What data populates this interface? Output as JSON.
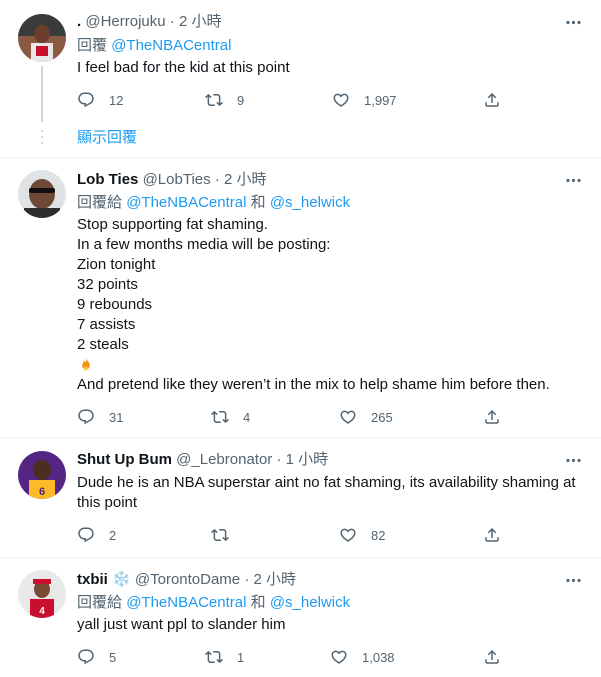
{
  "tweets": [
    {
      "name": ".",
      "handle": "@Herrojuku",
      "dot": "·",
      "time": "2 小時",
      "reply_prefix": "回覆",
      "mention1": "@TheNBACentral",
      "joiner": "",
      "mention2": "",
      "lines": [
        "I feel bad for the kid at this point"
      ],
      "reply_count": "12",
      "retweet_count": "9",
      "like_count": "1,997"
    },
    {
      "name": "Lob Ties",
      "handle": "@LobTies",
      "dot": "·",
      "time": "2 小時",
      "reply_prefix": "回覆給",
      "mention1": "@TheNBACentral",
      "joiner": "和",
      "mention2": "@s_helwick",
      "lines": [
        "Stop supporting fat shaming.",
        "In a few months media will be posting:",
        "Zion tonight",
        "32 points",
        "9 rebounds",
        "7 assists",
        "2 steals",
        "🔥",
        "And pretend like they weren’t in the mix to help shame him before then."
      ],
      "reply_count": "31",
      "retweet_count": "4",
      "like_count": "265"
    },
    {
      "name": "Shut Up Bum",
      "handle": "@_Lebronator",
      "dot": "·",
      "time": "1 小時",
      "lines": [
        "Dude he is an NBA superstar aint no fat shaming, its availability shaming at",
        "this point"
      ],
      "reply_count": "2",
      "retweet_count": "",
      "like_count": "82"
    },
    {
      "name": "txbii",
      "name_emoji": "❄️",
      "handle": "@TorontoDame",
      "dot": "·",
      "time": "2 小時",
      "reply_prefix": "回覆給",
      "mention1": "@TheNBACentral",
      "joiner": "和",
      "mention2": "@s_helwick",
      "lines": [
        "yall just want ppl to slander him"
      ],
      "reply_count": "5",
      "retweet_count": "1",
      "like_count": "1,038"
    }
  ],
  "show_replies": "顯示回覆",
  "icons": {
    "reply": "reply-icon",
    "retweet": "retweet-icon",
    "like": "heart-icon",
    "share": "share-icon",
    "more": "more-icon"
  },
  "colors": {
    "link": "#1d9bf0",
    "secondary": "#536471",
    "thread_line": "#cfd9de",
    "divider": "#eff3f4"
  }
}
